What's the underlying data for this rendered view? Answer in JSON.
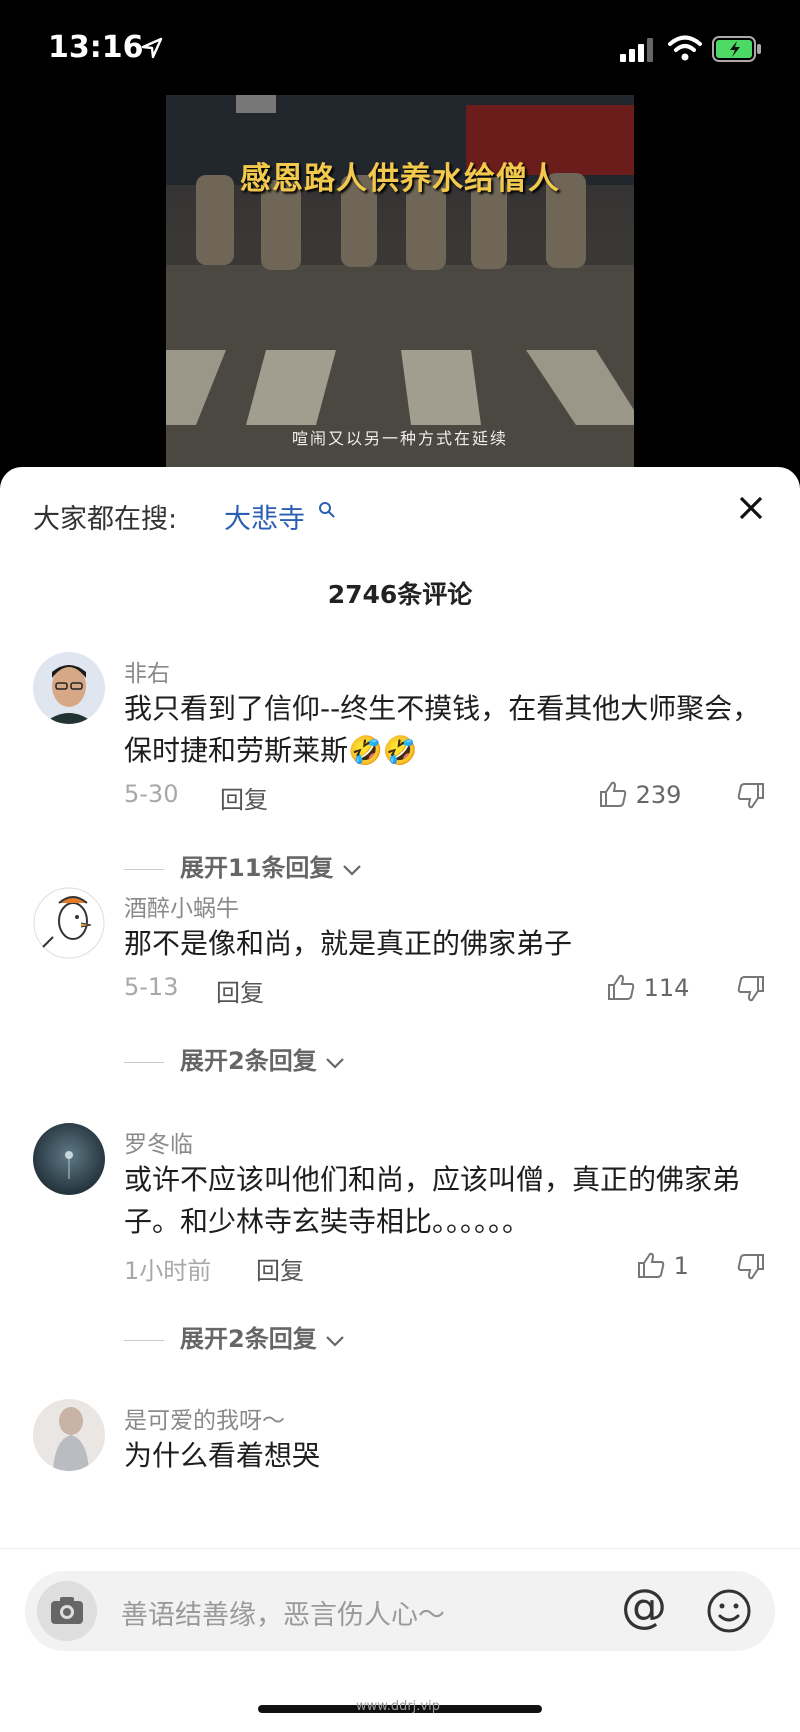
{
  "status": {
    "time": "13:16"
  },
  "video": {
    "title": "感恩路人供养水给僧人",
    "subtitle": "喧闹又以另一种方式在延续"
  },
  "search": {
    "label": "大家都在搜:",
    "link": "大悲寺"
  },
  "comment_count": "2746条评论",
  "comments": [
    {
      "name": "非右",
      "text": "我只看到了信仰--终生不摸钱，在看其他大师聚会，保时捷和劳斯莱斯🤣🤣",
      "date": "5-30",
      "reply": "回复",
      "likes": "239",
      "expand": "展开11条回复"
    },
    {
      "name": "酒醉小蜗牛",
      "text": "那不是像和尚，就是真正的佛家弟子",
      "date": "5-13",
      "reply": "回复",
      "likes": "114",
      "expand": "展开2条回复"
    },
    {
      "name": "罗冬临",
      "text": "或许不应该叫他们和尚，应该叫僧，真正的佛家弟子。和少林寺玄奘寺相比。。。。。。",
      "date": "1小时前",
      "reply": "回复",
      "likes": "1",
      "expand": "展开2条回复"
    },
    {
      "name": "是可爱的我呀～",
      "text": "为什么看着想哭"
    }
  ],
  "input": {
    "placeholder": "善语结善缘，恶言伤人心～",
    "at": "@"
  },
  "watermark": "www.ddrj.vip",
  "icons": [
    "location-arrow-icon",
    "signal-icon",
    "wifi-icon",
    "battery-icon",
    "search-icon",
    "close-icon",
    "thumb-up-icon",
    "thumb-down-icon",
    "chevron-down-icon",
    "camera-icon",
    "emoji-icon"
  ]
}
